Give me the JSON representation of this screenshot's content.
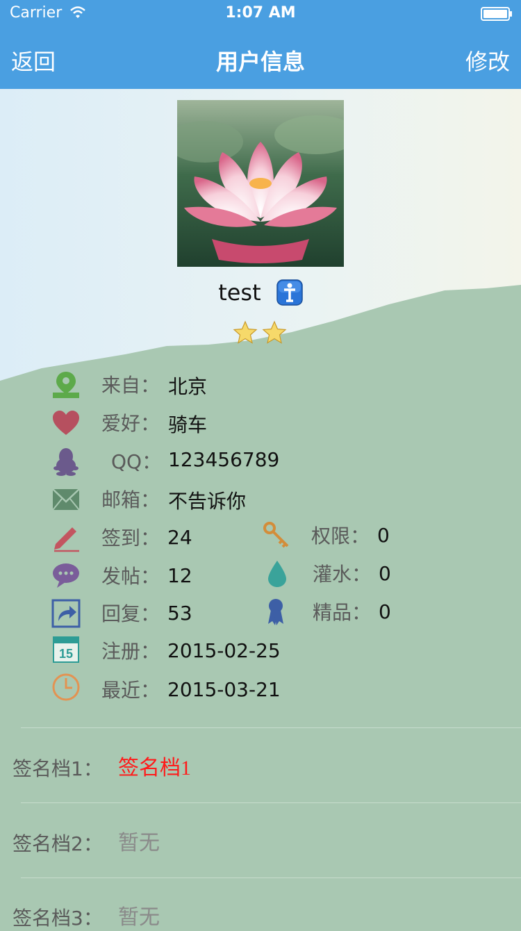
{
  "status_bar": {
    "carrier": "Carrier",
    "time": "1:07 AM"
  },
  "nav": {
    "back": "返回",
    "title": "用户信息",
    "edit": "修改"
  },
  "profile": {
    "username": "test",
    "stars": 2
  },
  "info": {
    "from_label": "来自：",
    "from": "北京",
    "hobby_label": "爱好：",
    "hobby": "骑车",
    "qq_label": "QQ：",
    "qq": "123456789",
    "email_label": "邮箱：",
    "email": "不告诉你",
    "checkin_label": "签到：",
    "checkin": "24",
    "permission_label": "权限：",
    "permission": "0",
    "posts_label": "发帖：",
    "posts": "12",
    "water_label": "灌水：",
    "water": "0",
    "replies_label": "回复：",
    "replies": "53",
    "elite_label": "精品：",
    "elite": "0",
    "register_label": "注册：",
    "register": "2015-02-25",
    "recent_label": "最近：",
    "recent": "2015-03-21",
    "calendar_day": "15"
  },
  "signatures": [
    {
      "label": "签名档1：",
      "value": "签名档1"
    },
    {
      "label": "签名档2：",
      "value": "暂无"
    },
    {
      "label": "签名档3：",
      "value": "暂无"
    }
  ],
  "colors": {
    "nav_bg": "#4a9fe1",
    "sky": "#e4f0f6",
    "land": "#a9c8b2",
    "sig_active": "#ff1a1a",
    "sig_empty": "#8a8a8a"
  }
}
